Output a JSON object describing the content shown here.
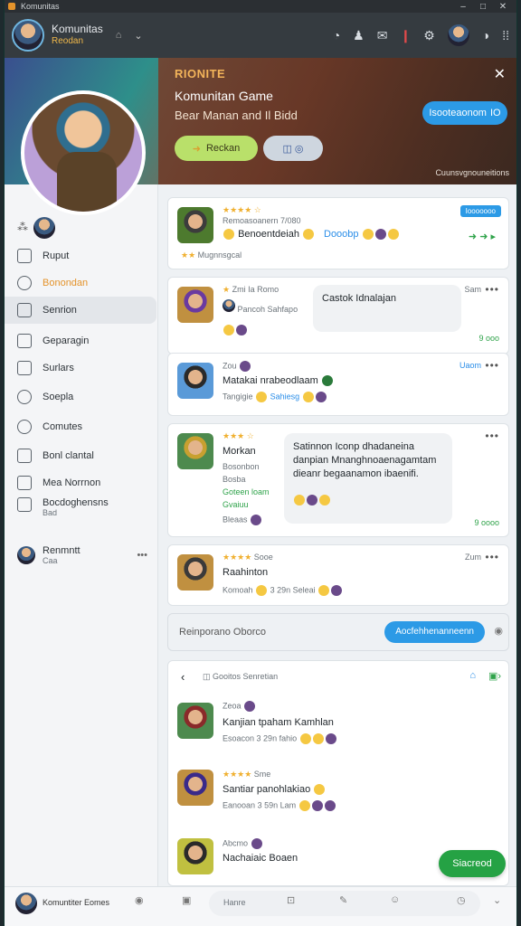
{
  "window": {
    "title": "Komunitas"
  },
  "topbar": {
    "name": "Komunitas",
    "status": "Reodan"
  },
  "hero": {
    "tag": "RIONITE",
    "title": "Komunitan Game",
    "subtitle": "Bear Manan and Il Bidd",
    "primary_button": "Reckan",
    "right_button": "Isooteaonom",
    "right_button_count": "IO",
    "footer": "Cuunsvgnouneitions"
  },
  "sidebar": {
    "items": [
      {
        "label": "Ruput"
      },
      {
        "label": "Bonondan"
      },
      {
        "label": "Senrion"
      },
      {
        "label": "Geparagin"
      },
      {
        "label": "Surlars"
      },
      {
        "label": "Soepla"
      },
      {
        "label": "Comutes"
      },
      {
        "label": "Bonl clantal"
      },
      {
        "label": "Mea Norrnon"
      },
      {
        "label": "Bocdoghensns",
        "sub": "Bad"
      },
      {
        "label": "Renmntt",
        "sub": "Caa"
      }
    ]
  },
  "feed": {
    "cards": [
      {
        "meta": "Remoasoanern 7/080",
        "title": "Benoentdeiah",
        "extra": "Dooobp",
        "tag": "Mugnnsgcal",
        "badge": "Iooooooo"
      },
      {
        "meta": "Zmi Ia Romo",
        "title": "Pancoh Sahfapo",
        "bubble": "Castok Idnalajan",
        "time": "Sam",
        "count": "9 ooo"
      },
      {
        "meta": "Zou",
        "title": "Matakai nrabeodlaam",
        "sub": "Tangigie",
        "extra": "Sahiesg",
        "time": "Uaom"
      },
      {
        "title": "Morkan",
        "sub1": "Bosonbon",
        "sub2": "Bosba",
        "sub3": "Goteen loam",
        "sub4": "Gvaiuu",
        "sub5": "Bleaas",
        "bubble": "Satinnon Iconp dhadaneina danpian Mnanghnoaenagamtam dieanr begaanamon ibaenifi.",
        "count": "9 oooo"
      },
      {
        "meta": "Sooe",
        "title": "Raahinton",
        "sub": "Komoah",
        "extra": "3 29n Seleai",
        "time": "Zum"
      }
    ],
    "reply_placeholder": "Reinporano Oborco",
    "reply_button": "Aocfehhenanneenn",
    "thread": {
      "title": "Gooitos Senretian",
      "items": [
        {
          "meta": "Zeoa",
          "title": "Kanjian tpaham Kamhlan",
          "sub": "Esoacon",
          "extra": "3 29n fahio"
        },
        {
          "meta": "Sme",
          "title": "Santiar panohlakiao",
          "sub": "Eanooan",
          "extra": "3 59n Lam"
        },
        {
          "meta": "Abcmo",
          "title": "Nachaiaic Boaen"
        }
      ]
    },
    "fab": "Siacreod"
  },
  "bottombar": {
    "name": "Komuntiter Eomes",
    "placeholder": "Hanre"
  }
}
